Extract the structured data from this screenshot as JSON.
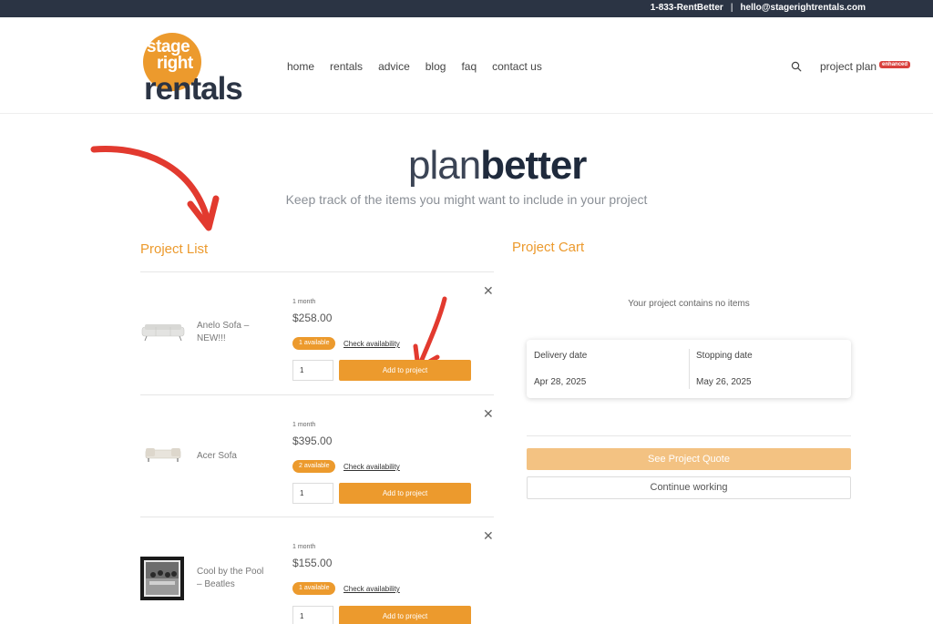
{
  "topbar": {
    "phone": "1-833-RentBetter",
    "separator": "|",
    "email": "hello@stagerightrentals.com"
  },
  "logo": {
    "line1": "stage",
    "line2": "right",
    "line3": "rentals"
  },
  "nav": {
    "items": [
      "home",
      "rentals",
      "advice",
      "blog",
      "faq",
      "contact us"
    ],
    "project_plan": "project plan",
    "badge": "enhanced"
  },
  "hero": {
    "title_light": "plan",
    "title_bold": "better",
    "subtitle": "Keep track of the items you might want to include in your project"
  },
  "project_list": {
    "title": "Project List",
    "items": [
      {
        "name": "Anelo Sofa – NEW!!!",
        "period": "1 month",
        "price": "$258.00",
        "availability": "1 available",
        "check": "Check availability",
        "qty": "1",
        "add": "Add to project",
        "remove": "✕"
      },
      {
        "name": "Acer Sofa",
        "period": "1 month",
        "price": "$395.00",
        "availability": "2 available",
        "check": "Check availability",
        "qty": "1",
        "add": "Add to project",
        "remove": "✕"
      },
      {
        "name": "Cool by the Pool – Beatles",
        "period": "1 month",
        "price": "$155.00",
        "availability": "1 available",
        "check": "Check availability",
        "qty": "1",
        "add": "Add to project",
        "remove": "✕"
      }
    ]
  },
  "project_cart": {
    "title": "Project Cart",
    "empty_text": "Your project contains no items",
    "delivery_label": "Delivery date",
    "delivery_value": "Apr 28, 2025",
    "stopping_label": "Stopping date",
    "stopping_value": "May 26, 2025",
    "quote_button": "See Project Quote",
    "continue_button": "Continue working"
  },
  "colors": {
    "accent": "#ec9a2d",
    "navy": "#2b3444",
    "badge_red": "#d9413d",
    "annotation_red": "#e23a2f"
  }
}
